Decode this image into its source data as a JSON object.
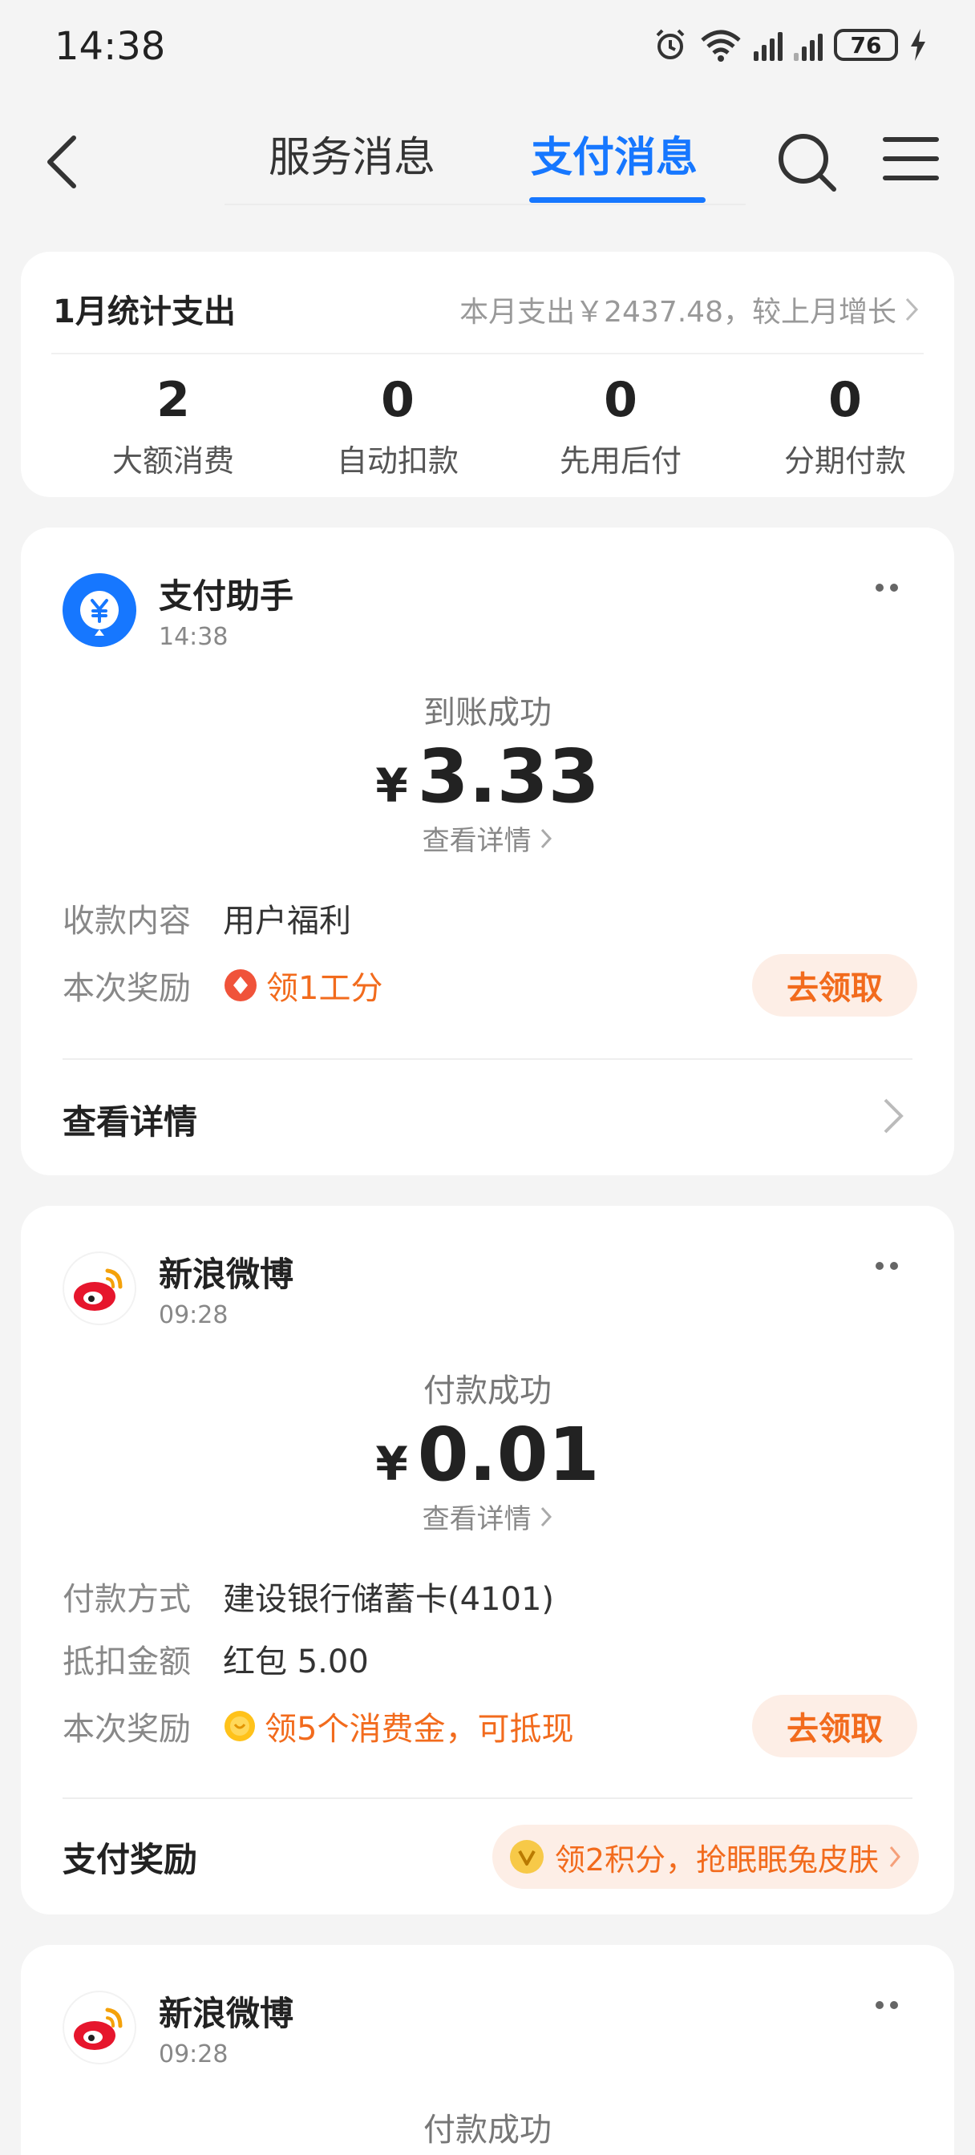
{
  "status_bar": {
    "time": "14:38",
    "battery": "76",
    "icons": [
      "alarm-icon",
      "wifi-icon",
      "signal-icon",
      "signal-icon",
      "battery-icon",
      "charging-icon"
    ]
  },
  "nav": {
    "tabs": [
      {
        "label": "服务消息",
        "active": false
      },
      {
        "label": "支付消息",
        "active": true
      }
    ],
    "accent": "#1677ff"
  },
  "summary": {
    "title": "1月统计支出",
    "desc": "本月支出￥2437.48，较上月增长",
    "stats": [
      {
        "value": "2",
        "label": "大额消费"
      },
      {
        "value": "0",
        "label": "自动扣款"
      },
      {
        "value": "0",
        "label": "先用后付"
      },
      {
        "value": "0",
        "label": "分期付款"
      }
    ]
  },
  "messages": [
    {
      "sender": "支付助手",
      "time": "14:38",
      "status": "到账成功",
      "currency": "¥",
      "amount": "3.33",
      "detail_link": "查看详情",
      "rows": [
        {
          "key": "收款内容",
          "value": "用户福利"
        },
        {
          "key": "本次奖励",
          "value": "领1工分"
        }
      ],
      "claim": "去领取",
      "footer": "查看详情"
    },
    {
      "sender": "新浪微博",
      "time": "09:28",
      "status": "付款成功",
      "currency": "¥",
      "amount": "0.01",
      "detail_link": "查看详情",
      "rows": [
        {
          "key": "付款方式",
          "value": "建设银行储蓄卡(4101)"
        },
        {
          "key": "抵扣金额",
          "value": "红包 5.00"
        },
        {
          "key": "本次奖励",
          "value": "领5个消费金，可抵现"
        }
      ],
      "claim": "去领取",
      "footer": "支付奖励",
      "promo": "领2积分，抢眠眠兔皮肤"
    },
    {
      "sender": "新浪微博",
      "time": "09:28",
      "status": "付款成功"
    }
  ],
  "colors": {
    "reward": "#f26b1d",
    "claim_bg": "#fdeee6",
    "page_bg": "#f4f4f4"
  }
}
